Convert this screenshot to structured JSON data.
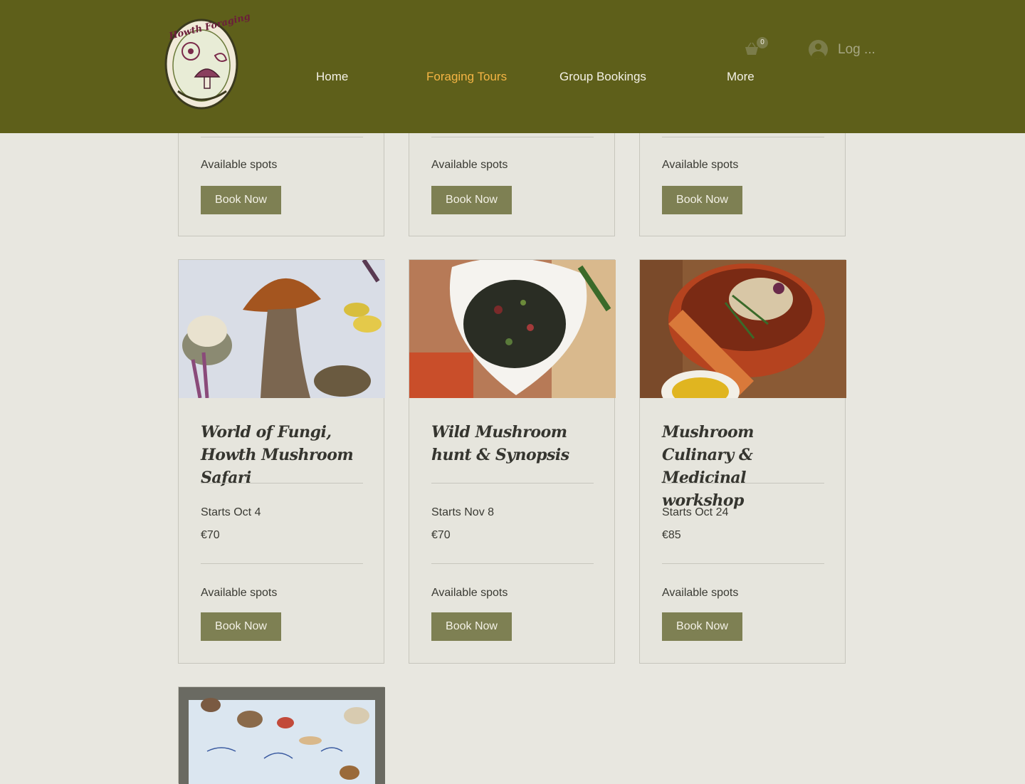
{
  "header": {
    "logo_text": "Howth Foraging",
    "nav": [
      {
        "label": "Home"
      },
      {
        "label": "Foraging Tours"
      },
      {
        "label": "Group Bookings"
      },
      {
        "label": "More"
      }
    ],
    "cart_count": "0",
    "login_label": "Log ..."
  },
  "colors": {
    "header_bg": "#5e5f1a",
    "nav_active": "#f5b544",
    "button_bg": "#7e8053",
    "page_bg": "#e8e7e0"
  },
  "top_row": [
    {
      "spots": "Available spots",
      "button": "Book Now"
    },
    {
      "spots": "Available spots",
      "button": "Book Now"
    },
    {
      "spots": "Available spots",
      "button": "Book Now"
    }
  ],
  "cards": [
    {
      "title": "World of Fungi, Howth Mushroom Safari",
      "date": "Starts Oct 4",
      "price": "€70",
      "spots": "Available spots",
      "button": "Book Now"
    },
    {
      "title": "Wild Mushroom hunt & Synopsis",
      "date": "Starts Nov 8",
      "price": "€70",
      "spots": "Available spots",
      "button": "Book Now"
    },
    {
      "title": "Mushroom Culinary & Medicinal workshop",
      "date": "Starts Oct 24",
      "price": "€85",
      "spots": "Available spots",
      "button": "Book Now"
    }
  ]
}
